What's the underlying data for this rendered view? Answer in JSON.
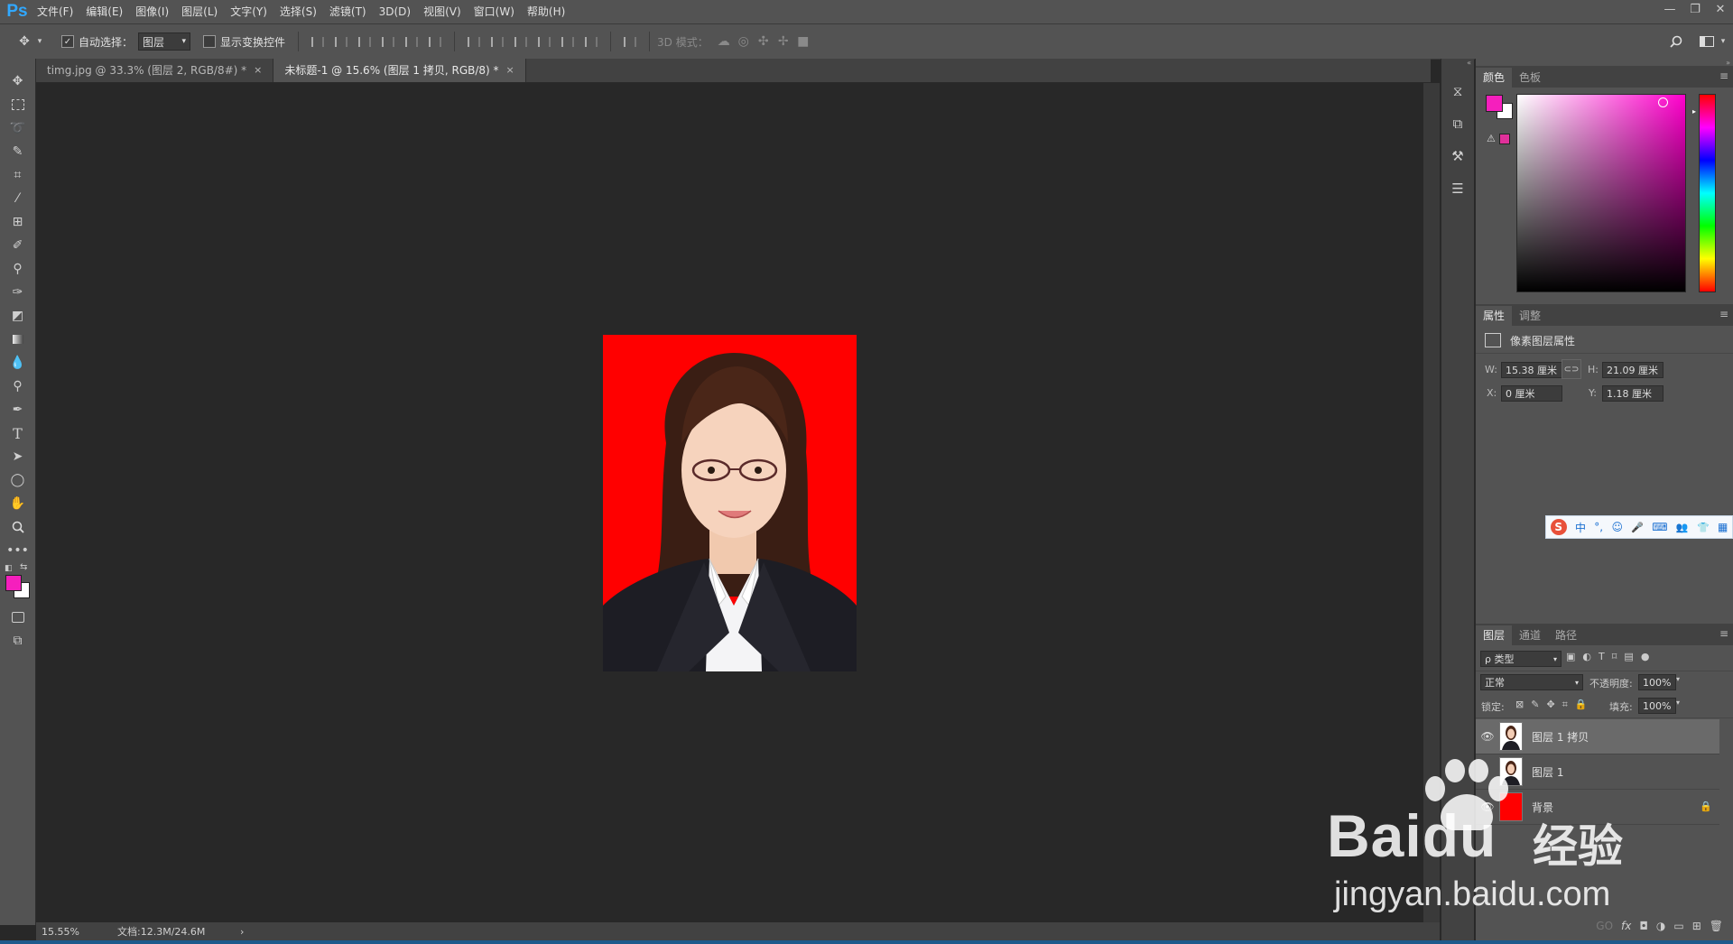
{
  "app": {
    "logo": "Ps"
  },
  "menu": [
    "文件(F)",
    "编辑(E)",
    "图像(I)",
    "图层(L)",
    "文字(Y)",
    "选择(S)",
    "滤镜(T)",
    "3D(D)",
    "视图(V)",
    "窗口(W)",
    "帮助(H)"
  ],
  "window_controls": [
    "—",
    "❐",
    "✕"
  ],
  "options": {
    "auto_select_label": "自动选择：",
    "auto_select_value": "图层",
    "show_transform_label": "显示变换控件",
    "mode_3d_label": "3D 模式："
  },
  "tabs": [
    {
      "label": "timg.jpg @ 33.3% (图层 2, RGB/8#) *",
      "close": "×"
    },
    {
      "label": "未标题-1 @ 15.6% (图层 1 拷贝, RGB/8) *",
      "close": "×"
    }
  ],
  "status": {
    "zoom": "15.55%",
    "doc": "文档:12.3M/24.6M",
    "arrow": "›"
  },
  "color_panel": {
    "tabs": [
      "颜色",
      "色板"
    ],
    "foreground": "#f51fbd",
    "background": "#ffffff"
  },
  "properties_panel": {
    "tabs": [
      "属性",
      "调整"
    ],
    "title": "像素图层属性",
    "w_label": "W:",
    "w_value": "15.38 厘米",
    "h_label": "H:",
    "h_value": "21.09 厘米",
    "x_label": "X:",
    "x_value": "0 厘米",
    "y_label": "Y:",
    "y_value": "1.18 厘米"
  },
  "ime_bar": {
    "icons": [
      "S",
      "中",
      "°,",
      "☺",
      "🎤",
      "⌨",
      "👥",
      "👕",
      "▦"
    ]
  },
  "layers_panel": {
    "tabs": [
      "图层",
      "通道",
      "路径"
    ],
    "filter_label": "ρ 类型",
    "blend_mode": "正常",
    "opacity_label": "不透明度:",
    "opacity_value": "100%",
    "lock_label": "锁定:",
    "fill_label": "填充:",
    "fill_value": "100%",
    "layers": [
      {
        "name": "图层 1 拷贝",
        "selected": true,
        "visible": true
      },
      {
        "name": "图层 1",
        "selected": false,
        "visible": false
      },
      {
        "name": "背景",
        "selected": false,
        "visible": true,
        "locked": true
      }
    ],
    "bottom_icons": [
      "GO",
      "fx",
      "◘",
      "◑",
      "▭",
      "⊞",
      "🗑"
    ]
  },
  "watermark": {
    "brand": "Baidu",
    "brand_suffix": "经验",
    "url": "jingyan.baidu.com"
  }
}
